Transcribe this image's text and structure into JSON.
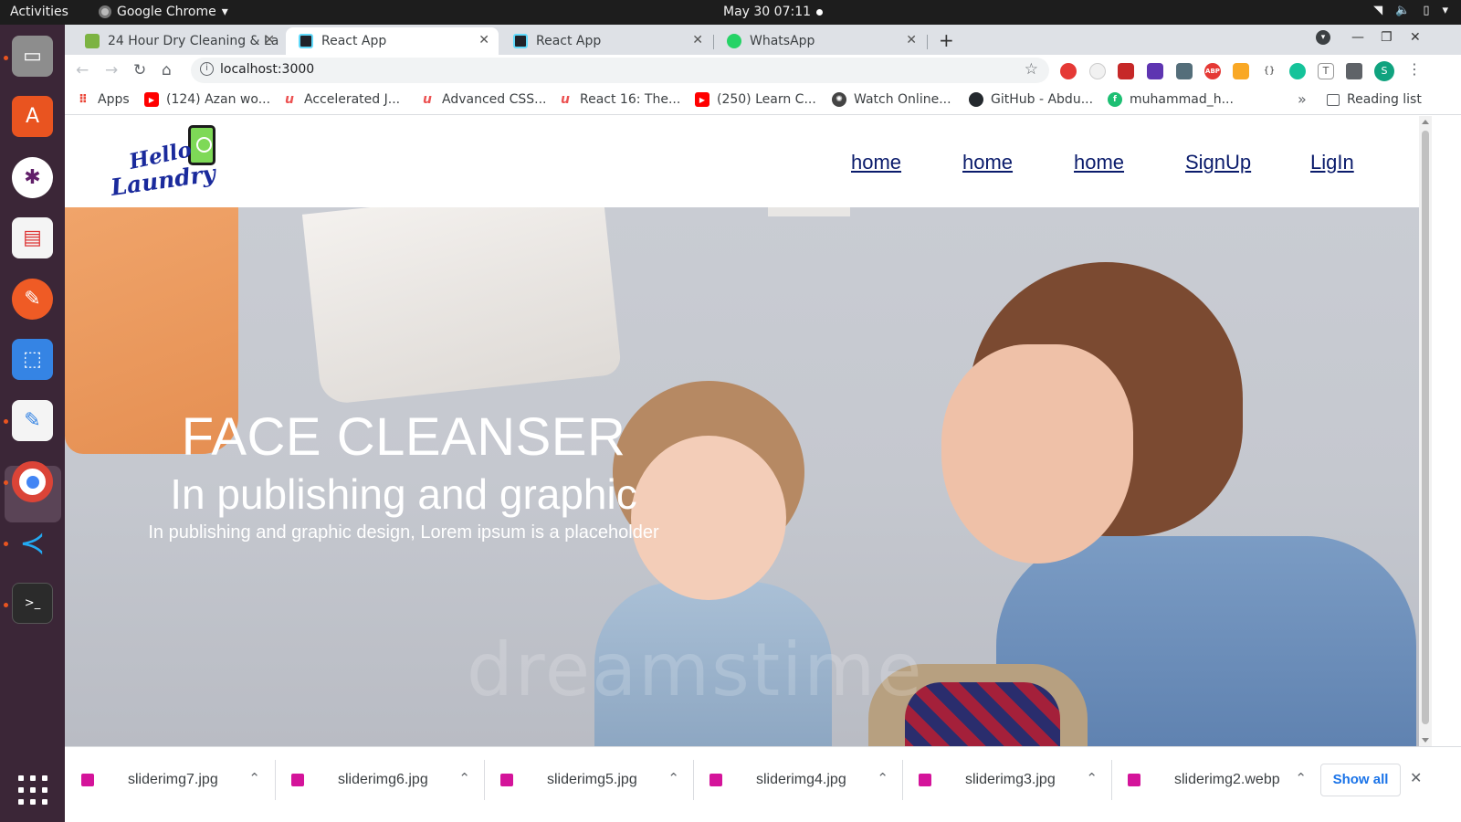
{
  "os": {
    "activities": "Activities",
    "app_menu": "Google Chrome",
    "clock": "May 30  07:11"
  },
  "tabs": [
    {
      "title": "24 Hour Dry Cleaning & La",
      "active": false
    },
    {
      "title": "React App",
      "active": true
    },
    {
      "title": "React App",
      "active": false
    },
    {
      "title": "WhatsApp",
      "active": false
    }
  ],
  "toolbar": {
    "url": "localhost:3000",
    "profile_initial": "S"
  },
  "bookmarks": [
    {
      "label": "Apps",
      "icon": "apps-grid-icon"
    },
    {
      "label": "(124) Azan wo...",
      "icon": "youtube-icon"
    },
    {
      "label": "Accelerated J...",
      "icon": "udemy-icon"
    },
    {
      "label": "Advanced CSS...",
      "icon": "udemy-icon"
    },
    {
      "label": "React 16: The...",
      "icon": "udemy-icon"
    },
    {
      "label": "(250) Learn C...",
      "icon": "youtube-icon"
    },
    {
      "label": "Watch Online...",
      "icon": "film-reel-icon"
    },
    {
      "label": "GitHub - Abdu...",
      "icon": "github-icon"
    },
    {
      "label": "muhammad_h...",
      "icon": "fiverr-icon"
    }
  ],
  "reading_list": "Reading list",
  "site": {
    "logo": {
      "line1": "Hello",
      "line2": "Laundry"
    },
    "nav": [
      "home",
      "home",
      "home",
      "SignUp",
      "LigIn"
    ],
    "hero": {
      "title": "FACE CLEANSER",
      "subtitle": "In publishing and graphic",
      "text": "In publishing and graphic design, Lorem ipsum is a placeholder",
      "watermark": "dreamstime"
    }
  },
  "downloads": [
    {
      "name": "sliderimg7.jpg"
    },
    {
      "name": "sliderimg6.jpg"
    },
    {
      "name": "sliderimg5.jpg"
    },
    {
      "name": "sliderimg4.jpg"
    },
    {
      "name": "sliderimg3.jpg"
    },
    {
      "name": "sliderimg2.webp"
    }
  ],
  "show_all": "Show all",
  "colors": {
    "nav_link": "#0a1b6b",
    "logo_blue": "#1a2a9c",
    "download_icon": "#d4149a",
    "show_all": "#1a73e8"
  }
}
